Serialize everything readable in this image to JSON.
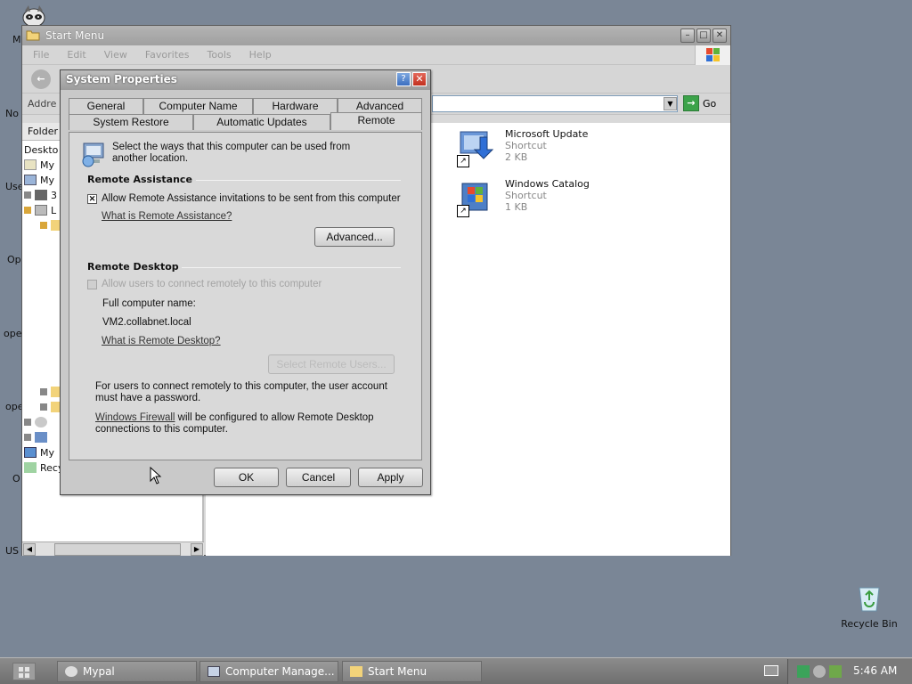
{
  "desktop": {
    "edge_labels": [
      "M",
      "No",
      "Use",
      "Op",
      "ope",
      "ope",
      "O",
      "US"
    ],
    "recycle_bin_label": "Recycle Bin"
  },
  "explorer": {
    "title": "Start Menu",
    "menu": [
      "File",
      "Edit",
      "View",
      "Favorites",
      "Tools",
      "Help"
    ],
    "address_label": "Addre",
    "go_label": "Go",
    "folders_label": "Folder",
    "tree_items": [
      "Deskto",
      "My",
      "My",
      "3",
      "L",
      "My",
      "Recy"
    ],
    "files": [
      {
        "name": "Microsoft Update",
        "type": "Shortcut",
        "size": "2 KB",
        "icon": "microsoft-update-icon"
      },
      {
        "name": "Windows Catalog",
        "type": "Shortcut",
        "size": "1 KB",
        "icon": "windows-catalog-icon"
      }
    ]
  },
  "system_properties": {
    "title": "System Properties",
    "tabs_row1": [
      "General",
      "Computer Name",
      "Hardware",
      "Advanced"
    ],
    "tabs_row2": [
      "System Restore",
      "Automatic Updates",
      "Remote"
    ],
    "active_tab": "Remote",
    "intro": "Select the ways that this computer can be used from another location.",
    "remote_assistance": {
      "heading": "Remote Assistance",
      "checkbox_label": "Allow Remote Assistance invitations to be sent from this computer",
      "checked": true,
      "link": "What is Remote Assistance?",
      "advanced_button": "Advanced..."
    },
    "remote_desktop": {
      "heading": "Remote Desktop",
      "checkbox_label": "Allow users to connect remotely to this computer",
      "checked": false,
      "full_name_label": "Full computer name:",
      "full_name_value": "VM2.collabnet.local",
      "link": "What is Remote Desktop?",
      "select_users_button": "Select Remote Users...",
      "note1": "For users to connect remotely to this computer, the user account must have a password.",
      "firewall_link": "Windows Firewall",
      "note2": " will be configured to allow Remote Desktop connections to this computer."
    },
    "buttons": {
      "ok": "OK",
      "cancel": "Cancel",
      "apply": "Apply"
    }
  },
  "taskbar": {
    "tasks": [
      "Mypal",
      "Computer Manage...",
      "Start Menu"
    ],
    "clock": "5:46 AM"
  }
}
